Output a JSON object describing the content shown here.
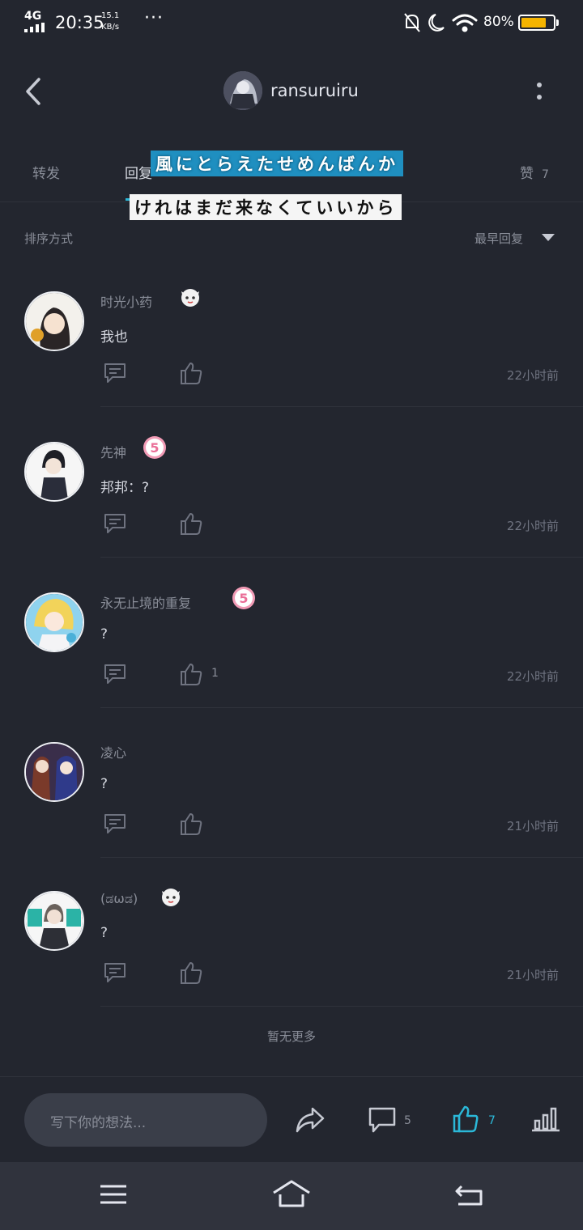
{
  "status_bar": {
    "network": "4G",
    "time": "20:35",
    "speed_value": "15.1",
    "speed_unit": "KB/s",
    "more": "···",
    "battery_pct": "80%",
    "battery_level": 0.8,
    "battery_color": "#f5b400"
  },
  "header": {
    "title": "ransuruiru",
    "back_icon": "chevron-left-icon",
    "more_icon": "more-vertical-icon"
  },
  "tabs": {
    "forward": "转发",
    "reply": "回复",
    "like": "赞",
    "like_count": "7"
  },
  "lyrics": {
    "line1": "風にとらえたせめんばんか",
    "line2": "けれはまだ来なくていいから"
  },
  "sort": {
    "label": "排序方式",
    "selected": "最早回复"
  },
  "comments": [
    {
      "user": "时光小药",
      "text": "我也",
      "likes": "",
      "time": "22小时前",
      "badge": "mascot-icon"
    },
    {
      "user": "先神",
      "text": "邦邦：?",
      "likes": "",
      "time": "22小时前",
      "badge": "level-5-icon"
    },
    {
      "user": "永无止境的重复",
      "text": "?",
      "likes": "1",
      "time": "22小时前",
      "badge": "level-5-icon"
    },
    {
      "user": "凌心",
      "text": "?",
      "likes": "",
      "time": "21小时前",
      "badge": ""
    },
    {
      "user": "(ಡωಡ)",
      "text": "?",
      "likes": "",
      "time": "21小时前",
      "badge": "mascot-icon"
    }
  ],
  "no_more": "暂无更多",
  "bottom_bar": {
    "placeholder": "写下你的想法...",
    "comment_count": "5",
    "like_count": "7",
    "accent_color": "#2bb8d8"
  },
  "nav_bar": {
    "menu_icon": "menu-icon",
    "home_icon": "home-icon",
    "back_icon": "back-arrow-icon"
  }
}
